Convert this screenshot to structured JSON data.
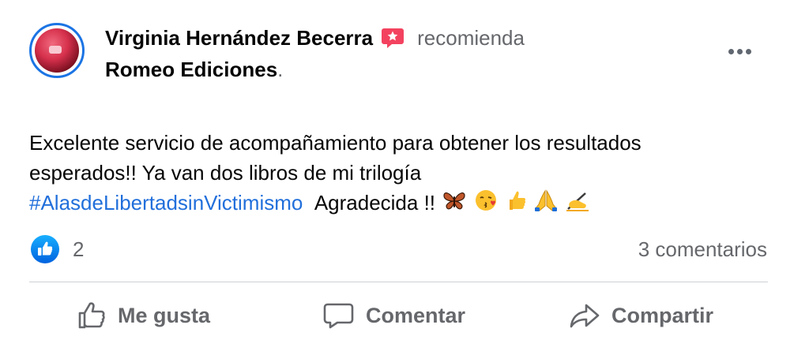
{
  "post": {
    "author": "Virginia Hernández Becerra",
    "action_word": "recomienda",
    "page_name": "Romeo Ediciones",
    "page_suffix": ".",
    "text_line1": "Excelente servicio de acompañamiento para obtener los  resultados",
    "text_line2": "esperados!! Ya van dos libros de mi trilogía",
    "hashtag": "#AlasdeLibertadsinVictimismo",
    "text_after_hashtag": "Agradecida !!",
    "emojis": [
      "butterfly",
      "kissing-face",
      "thumbs-up",
      "folded-hands",
      "writing-hand"
    ],
    "like_count": "2",
    "comments_label": "3 comentarios"
  },
  "actions": {
    "like_label": "Me gusta",
    "comment_label": "Comentar",
    "share_label": "Compartir"
  },
  "colors": {
    "accent": "#1b74e4",
    "hashtag": "#216fdb",
    "muted_text": "#65676b",
    "recommend_badge": "#f3425f"
  }
}
